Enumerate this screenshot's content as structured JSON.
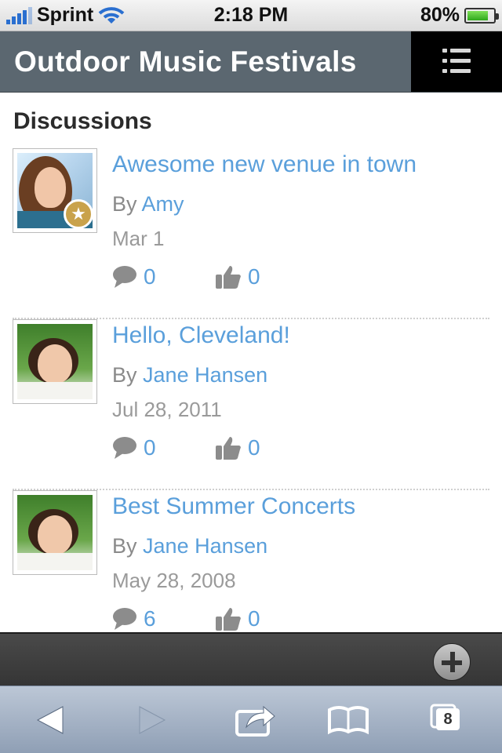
{
  "status_bar": {
    "carrier": "Sprint",
    "time": "2:18 PM",
    "battery_percent": "80%",
    "battery_level": 0.8
  },
  "header": {
    "title": "Outdoor Music Festivals",
    "menu_icon": "list-menu-icon"
  },
  "section": {
    "title": "Discussions"
  },
  "posts": [
    {
      "title": "Awesome new venue in town",
      "by_label": "By",
      "author": "Amy",
      "date": "Mar 1",
      "comments": "0",
      "likes": "0",
      "badge": "star-badge-icon"
    },
    {
      "title": "Hello, Cleveland!",
      "by_label": "By",
      "author": "Jane Hansen",
      "date": "Jul 28, 2011",
      "comments": "0",
      "likes": "0"
    },
    {
      "title": "Best Summer Concerts",
      "by_label": "By",
      "author": "Jane Hansen",
      "date": "May 28, 2008",
      "comments": "6",
      "likes": "0"
    }
  ],
  "toolbar": {
    "add_icon": "plus-circle-icon"
  },
  "browser_nav": {
    "tab_count": "8"
  },
  "colors": {
    "link": "#5a9fdb",
    "header_bg": "#5b6770",
    "badge": "#c9a24b"
  }
}
